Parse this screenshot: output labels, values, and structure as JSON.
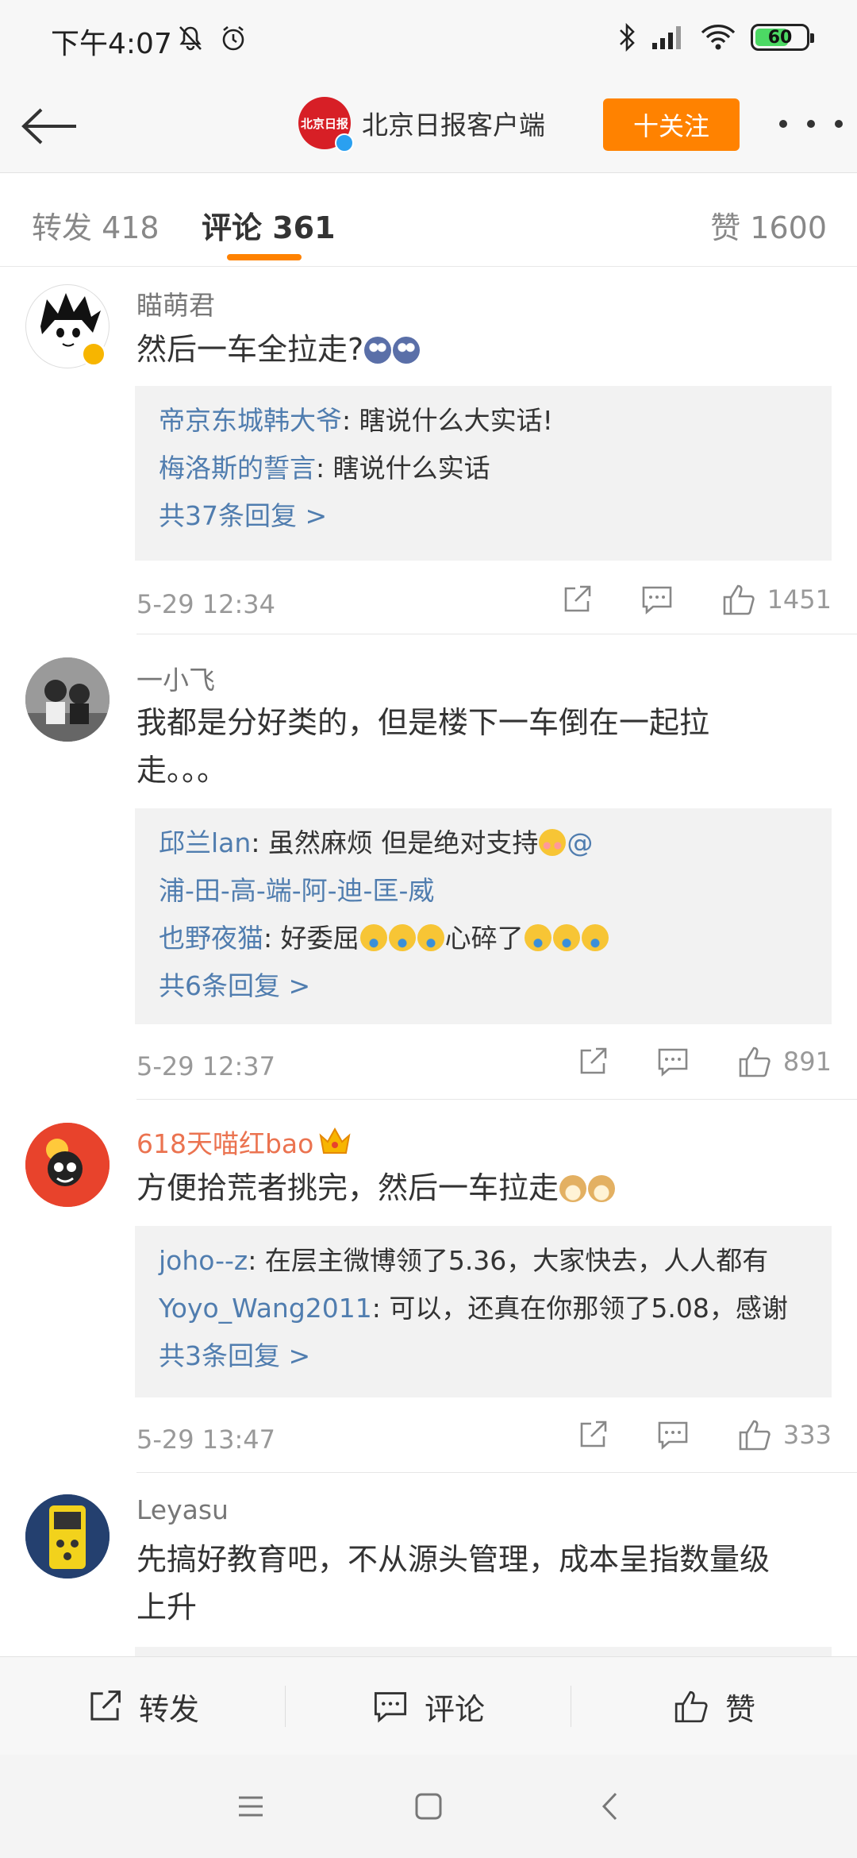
{
  "status_bar": {
    "time": "下午4:07",
    "battery": "60",
    "battery_level": 0.6,
    "icons": [
      "mute-icon",
      "alarm-icon",
      "bluetooth-icon",
      "signal-icon",
      "wifi-icon",
      "battery-icon"
    ]
  },
  "header": {
    "account_name": "北京日报客户端",
    "avatar_text": "北京日报",
    "follow_label": "十关注"
  },
  "tabs": {
    "repost": "转发 418",
    "comment": "评论 361",
    "like": "赞 1600"
  },
  "comments": [
    {
      "author": "瞄萌君",
      "text": "然后一车全拉走?",
      "replies": [
        {
          "user": "帝京东城韩大爷",
          "text": ": 瞎说什么大实话!"
        },
        {
          "user": "梅洛斯的誓言",
          "text": ": 瞎说什么实话"
        }
      ],
      "reply_more": "共37条回复 >",
      "time": "5-29 12:34",
      "likes": "1451"
    },
    {
      "author": "一小飞",
      "text": "我都是分好类的，但是楼下一车倒在一起拉走。。。",
      "replies": [
        {
          "user": "邱兰lan",
          "text": ": 虽然麻烦  但是绝对支持",
          "mention": "@",
          "mention2": "浦-田-高-端-阿-迪-匡-威"
        },
        {
          "user": "也野夜猫",
          "text": ": 好委屈",
          "text2": "心碎了"
        }
      ],
      "reply_more": "共6条回复 >",
      "time": "5-29 12:37",
      "likes": "891"
    },
    {
      "author": "618天喵红bao",
      "text": "方便拾荒者挑完，然后一车拉走",
      "replies": [
        {
          "user": "joho--z",
          "text": ": 在层主微博领了5.36，大家快去，人人都有"
        },
        {
          "user": "Yoyo_Wang2011",
          "text": ": 可以，还真在你那领了5.08，感谢"
        }
      ],
      "reply_more": "共3条回复 >",
      "time": "5-29 13:47",
      "likes": "333"
    },
    {
      "author": "Leyasu",
      "text": "先搞好教育吧，不从源头管理，成本呈指数量级上升"
    }
  ],
  "bottom_bar": {
    "repost": "转发",
    "comment": "评论",
    "like": "赞"
  },
  "colors": {
    "accent": "#ff8200",
    "link": "#507daf",
    "author_vip": "#eb7350"
  }
}
